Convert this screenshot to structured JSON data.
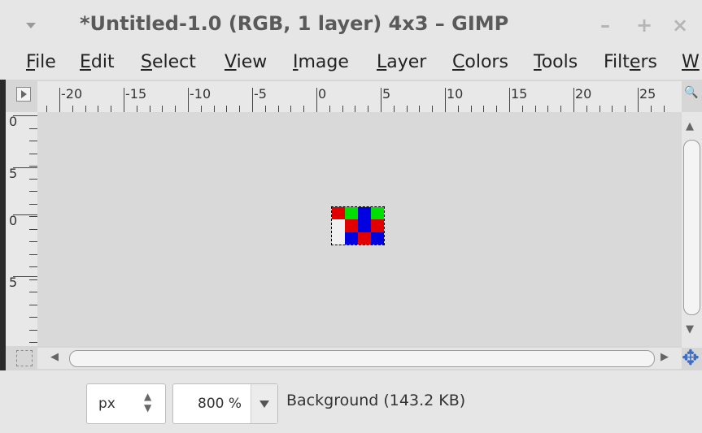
{
  "window": {
    "title": "*Untitled-1.0 (RGB, 1 layer) 4x3 – GIMP",
    "minimize": "–",
    "maximize": "+",
    "close": "×"
  },
  "menu": {
    "items": [
      {
        "pre": "",
        "u": "F",
        "post": "ile"
      },
      {
        "pre": "",
        "u": "E",
        "post": "dit"
      },
      {
        "pre": "",
        "u": "S",
        "post": "elect"
      },
      {
        "pre": "",
        "u": "V",
        "post": "iew"
      },
      {
        "pre": "",
        "u": "I",
        "post": "mage"
      },
      {
        "pre": "",
        "u": "L",
        "post": "ayer"
      },
      {
        "pre": "",
        "u": "C",
        "post": "olors"
      },
      {
        "pre": "",
        "u": "T",
        "post": "ools"
      },
      {
        "pre": "Filt",
        "u": "e",
        "post": "rs"
      },
      {
        "pre": "",
        "u": "W",
        "post": ""
      }
    ]
  },
  "ruler": {
    "h_labels": [
      "-20",
      "-15",
      "-10",
      "-5",
      "0",
      "5",
      "10",
      "15",
      "20",
      "25"
    ],
    "v_labels": [
      "0",
      "5",
      "0",
      "5"
    ]
  },
  "image": {
    "pixels": [
      "#e00000",
      "#00e000",
      "#0000e0",
      "#00e000",
      "#f0f0f0",
      "#e00000",
      "#0000e0",
      "#e00000",
      "#f0f0f0",
      "#0000e0",
      "#e00000",
      "#0000e0"
    ]
  },
  "statusbar": {
    "unit": "px",
    "zoom": "800 %",
    "layer_info": "Background (143.2 KB)"
  },
  "icons": {
    "ruler_menu": "triangle-right-icon",
    "zoom": "zoom-icon",
    "quick_mask": "quick-mask-icon",
    "navigate": "navigate-icon"
  }
}
